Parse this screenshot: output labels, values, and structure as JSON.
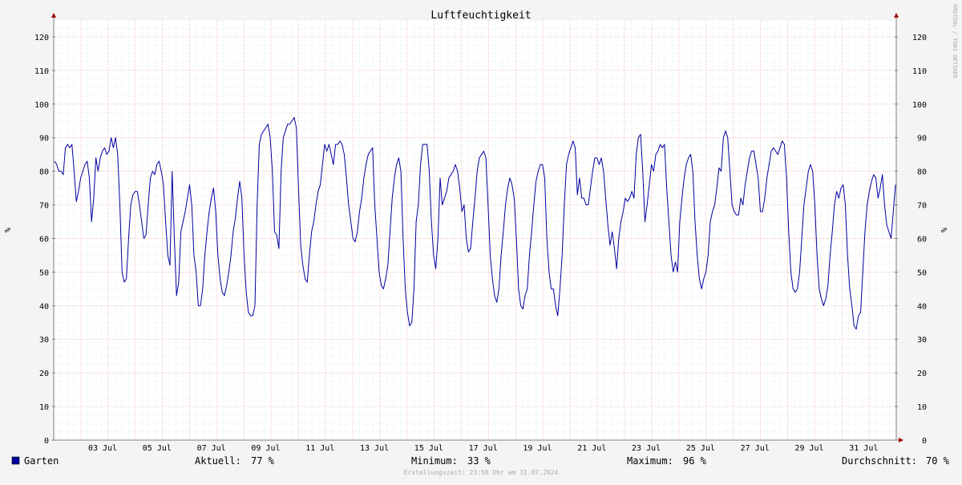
{
  "chart_data": {
    "type": "line",
    "title": "Luftfeuchtigkeit",
    "ylabel": "%",
    "xlabel": "",
    "ylim": [
      0,
      125
    ],
    "y_ticks": [
      0,
      10,
      20,
      30,
      40,
      50,
      60,
      70,
      80,
      90,
      100,
      110,
      120
    ],
    "x_ticks": [
      "03 Jul",
      "05 Jul",
      "07 Jul",
      "09 Jul",
      "11 Jul",
      "13 Jul",
      "15 Jul",
      "17 Jul",
      "19 Jul",
      "21 Jul",
      "23 Jul",
      "25 Jul",
      "27 Jul",
      "29 Jul",
      "31 Jul"
    ],
    "grid": true,
    "series": [
      {
        "name": "Garten",
        "color": "#0000a0",
        "values": [
          83,
          82,
          80,
          80,
          79,
          87,
          88,
          87,
          88,
          80,
          71,
          74,
          78,
          80,
          82,
          83,
          78,
          65,
          72,
          84,
          80,
          84,
          86,
          87,
          85,
          86,
          90,
          87,
          90,
          85,
          70,
          50,
          47,
          48,
          60,
          70,
          73,
          74,
          74,
          70,
          65,
          60,
          61,
          70,
          78,
          80,
          79,
          82,
          83,
          80,
          76,
          65,
          55,
          52,
          80,
          60,
          43,
          47,
          62,
          65,
          68,
          72,
          76,
          70,
          55,
          50,
          40,
          40,
          45,
          55,
          62,
          68,
          72,
          75,
          68,
          55,
          48,
          44,
          43,
          46,
          50,
          55,
          62,
          66,
          72,
          77,
          72,
          55,
          44,
          38,
          37,
          37,
          40,
          70,
          88,
          91,
          92,
          93,
          94,
          90,
          80,
          62,
          61,
          57,
          80,
          90,
          92,
          94,
          94,
          95,
          96,
          93,
          75,
          58,
          52,
          48,
          47,
          55,
          62,
          65,
          70,
          74,
          76,
          82,
          88,
          86,
          88,
          85,
          82,
          88,
          88,
          89,
          88,
          85,
          78,
          70,
          65,
          60,
          59,
          62,
          68,
          72,
          78,
          82,
          85,
          86,
          87,
          70,
          60,
          50,
          46,
          45,
          48,
          52,
          62,
          72,
          78,
          82,
          84,
          80,
          60,
          45,
          38,
          34,
          35,
          45,
          65,
          70,
          82,
          88,
          88,
          88,
          80,
          65,
          55,
          51,
          60,
          78,
          70,
          72,
          74,
          78,
          79,
          80,
          82,
          80,
          75,
          68,
          70,
          60,
          56,
          57,
          65,
          72,
          80,
          84,
          85,
          86,
          84,
          70,
          55,
          48,
          43,
          41,
          45,
          55,
          62,
          70,
          75,
          78,
          76,
          72,
          60,
          45,
          40,
          39,
          43,
          45,
          55,
          62,
          70,
          77,
          80,
          82,
          82,
          78,
          60,
          50,
          45,
          45,
          40,
          37,
          45,
          55,
          70,
          82,
          85,
          87,
          89,
          87,
          73,
          78,
          72,
          72,
          70,
          70,
          75,
          80,
          84,
          84,
          82,
          84,
          80,
          72,
          64,
          58,
          62,
          57,
          51,
          60,
          65,
          68,
          72,
          71,
          72,
          74,
          72,
          85,
          90,
          91,
          80,
          65,
          70,
          76,
          82,
          80,
          85,
          86,
          88,
          87,
          88,
          75,
          65,
          55,
          50,
          53,
          50,
          65,
          72,
          78,
          82,
          84,
          85,
          80,
          65,
          55,
          48,
          45,
          48,
          50,
          55,
          65,
          68,
          70,
          75,
          81,
          80,
          90,
          92,
          90,
          80,
          70,
          68,
          67,
          67,
          72,
          70,
          76,
          80,
          84,
          86,
          86,
          82,
          78,
          68,
          68,
          72,
          78,
          82,
          86,
          87,
          86,
          85,
          87,
          89,
          88,
          78,
          62,
          50,
          45,
          44,
          45,
          50,
          60,
          70,
          75,
          80,
          82,
          80,
          70,
          55,
          45,
          42,
          40,
          42,
          46,
          55,
          62,
          70,
          74,
          72,
          75,
          76,
          70,
          55,
          45,
          40,
          34,
          33,
          37,
          38,
          50,
          62,
          70,
          74,
          77,
          79,
          78,
          72,
          75,
          79,
          70,
          64,
          62,
          60,
          68,
          76
        ]
      }
    ],
    "legend": {
      "series_label": "Garten",
      "current_label": "Aktuell:",
      "current_value": "77 %",
      "min_label": "Minimum:",
      "min_value": "33 %",
      "max_label": "Maximum:",
      "max_value": "96 %",
      "avg_label": "Durchschnitt:",
      "avg_value": "70 %"
    },
    "watermark": "RRDTOOL / TOBI OETIKER",
    "footer": "Erstellungszeit: 23:58 Uhr am 31.07.2024",
    "colors": {
      "background": "#f4f4f4",
      "canvas": "#ffffff",
      "line": "#0000a0",
      "grid_minor": "#dddddd",
      "grid_major": "#f2a0a0",
      "axis": "#808080",
      "arrow": "#a00000"
    }
  }
}
